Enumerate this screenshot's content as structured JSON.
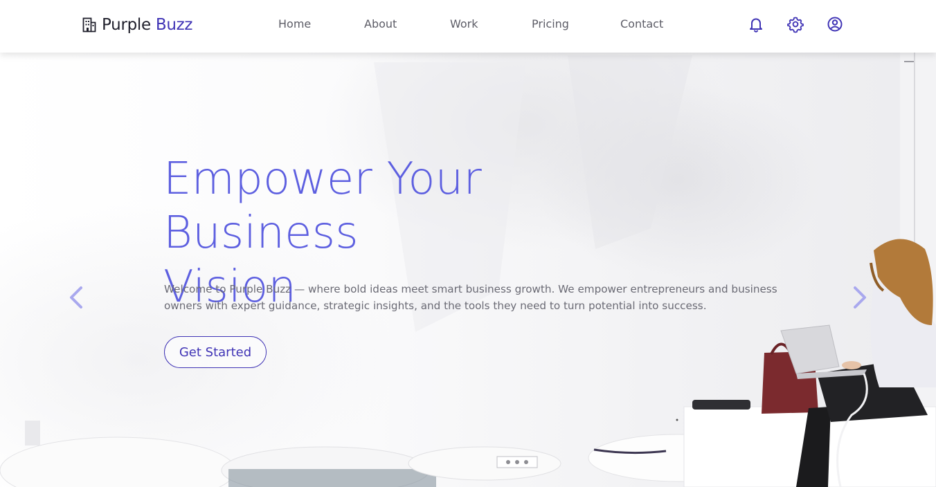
{
  "brand": {
    "name": "Purple",
    "accent": "Buzz"
  },
  "nav": {
    "links": [
      "Home",
      "About",
      "Work",
      "Pricing",
      "Contact"
    ],
    "icons": [
      "bell-icon",
      "gear-icon",
      "user-circle-icon"
    ]
  },
  "hero": {
    "headline_line1": "Empower Your Business",
    "headline_line2": "Vision",
    "intro": "Welcome to Purple Buzz — where bold ideas meet smart business growth. We empower entrepreneurs and business owners with expert guidance, strategic insights, and the tools they need to turn potential into success.",
    "cta_label": "Get Started"
  },
  "carousel": {
    "prev_icon": "chevron-left-icon",
    "next_icon": "chevron-right-icon"
  },
  "colors": {
    "accent": "#3f33b5",
    "headline": "#5d5fe0",
    "arrow": "#a9a8ee",
    "body_text": "#6a6a74"
  }
}
